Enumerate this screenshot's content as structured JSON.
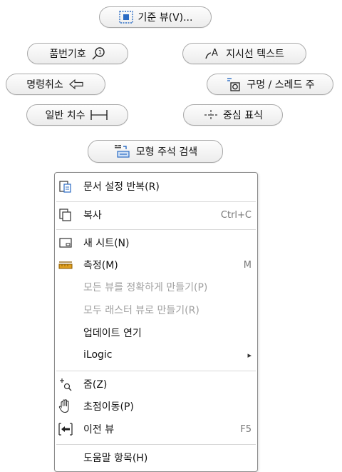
{
  "buttons": {
    "base_view": "기준 뷰(V)...",
    "balloon": "품번기호",
    "leader_text": "지시선 텍스트",
    "cancel": "명령취소",
    "hole_thread": "구멍 / 스레드 주",
    "general_dimension": "일반 치수",
    "center_mark": "중심 표식",
    "retrieve_model_annotations": "모형 주석 검색"
  },
  "menu": {
    "items": [
      {
        "label": "문서 설정 반복(R)",
        "shortcut": "",
        "enabled": true
      },
      {
        "label": "복사",
        "shortcut": "Ctrl+C",
        "enabled": true
      },
      {
        "label": "새 시트(N)",
        "shortcut": "",
        "enabled": true
      },
      {
        "label": "측정(M)",
        "shortcut": "M",
        "enabled": true
      },
      {
        "label": "모든 뷰를 정확하게 만들기(P)",
        "shortcut": "",
        "enabled": false
      },
      {
        "label": "모두 래스터 뷰로 만들기(R)",
        "shortcut": "",
        "enabled": false
      },
      {
        "label": "업데이트 연기",
        "shortcut": "",
        "enabled": true
      },
      {
        "label": "iLogic",
        "shortcut": "▸",
        "enabled": true
      },
      {
        "label": "줌(Z)",
        "shortcut": "",
        "enabled": true
      },
      {
        "label": "초점이동(P)",
        "shortcut": "",
        "enabled": true
      },
      {
        "label": "이전 뷰",
        "shortcut": "F5",
        "enabled": true
      },
      {
        "label": "도움말 항목(H)",
        "shortcut": "",
        "enabled": true
      }
    ]
  },
  "colors": {
    "accent": "#2b6cc4",
    "measure": "#e0a020"
  }
}
